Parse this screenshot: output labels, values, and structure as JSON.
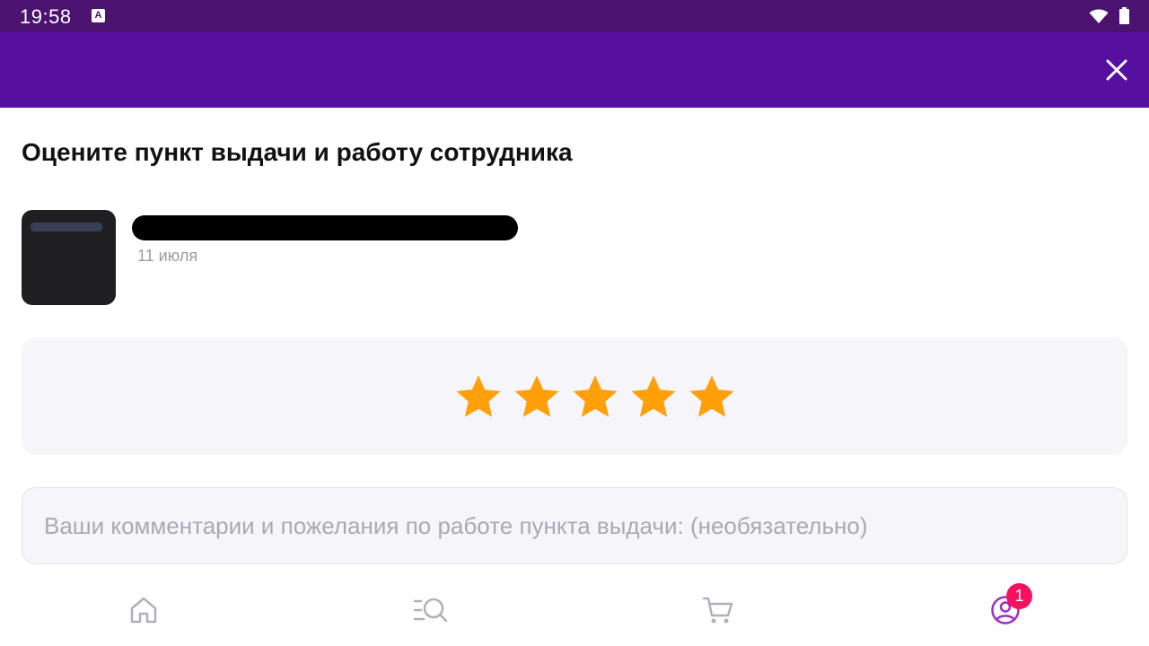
{
  "status_bar": {
    "time": "19:58",
    "notification_icon_letter": "A",
    "icons": [
      "wifi-icon",
      "battery-icon"
    ]
  },
  "header": {
    "close_icon": "close-icon",
    "background_color": "#560f9e"
  },
  "main": {
    "title": "Оцените пункт выдачи и работу сотрудника",
    "pickup_point": {
      "date": "11 июля",
      "name_redacted": true
    },
    "rating": {
      "stars_filled": 5,
      "stars_total": 5,
      "star_color": "#ff9f0a"
    },
    "comment": {
      "value": "",
      "placeholder": "Ваши комментарии и пожелания по работе пункта выдачи: (необязательно)"
    }
  },
  "bottom_nav": {
    "items": [
      {
        "icon": "home-icon",
        "active": false
      },
      {
        "icon": "catalog-search-icon",
        "active": false
      },
      {
        "icon": "cart-icon",
        "active": false
      },
      {
        "icon": "profile-icon",
        "active": true
      }
    ],
    "profile_badge": "1",
    "active_color": "#9b2fc5",
    "inactive_color": "#b0b0bd",
    "badge_color": "#f5115e"
  }
}
